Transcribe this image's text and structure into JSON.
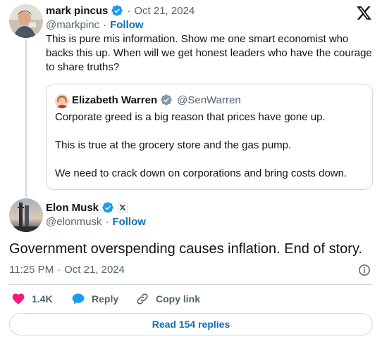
{
  "reply_tweet": {
    "author_name": "mark pincus",
    "handle": "@markpinc",
    "separator": "·",
    "date": "Oct 21, 2024",
    "follow_label": "Follow",
    "text": "This is pure mis information. Show me one smart economist who backs this up. When will we get honest leaders who have the courage to share truths?"
  },
  "quoted_tweet": {
    "author_name": "Elizabeth Warren",
    "handle": "@SenWarren",
    "paragraphs": [
      "Corporate greed is a big reason that prices have gone up.",
      "This is true at the grocery store and the gas pump.",
      "We need to crack down on corporations and bring costs down."
    ]
  },
  "main_tweet": {
    "author_name": "Elon Musk",
    "handle": "@elonmusk",
    "separator": "·",
    "follow_label": "Follow",
    "text": "Government overspending causes inflation. End of story.",
    "time": "11:25 PM",
    "date": "Oct 21, 2024",
    "meta_separator": "·"
  },
  "actions": {
    "like_count": "1.4K",
    "reply_label": "Reply",
    "copy_link_label": "Copy link"
  },
  "read_replies_label": "Read 154 replies",
  "icons": {
    "logo": "x-logo-icon",
    "verified": "verified-badge-icon",
    "affiliate": "x-affiliate-badge-icon",
    "info": "info-icon",
    "like": "heart-icon",
    "reply": "speech-bubble-icon",
    "copy": "link-icon"
  },
  "colors": {
    "accent_blue": "#1d9bf0",
    "link_blue": "#0f6fb4",
    "like_pink": "#f91880",
    "text": "#0f1419",
    "muted": "#536471",
    "border": "#cfd9de"
  }
}
